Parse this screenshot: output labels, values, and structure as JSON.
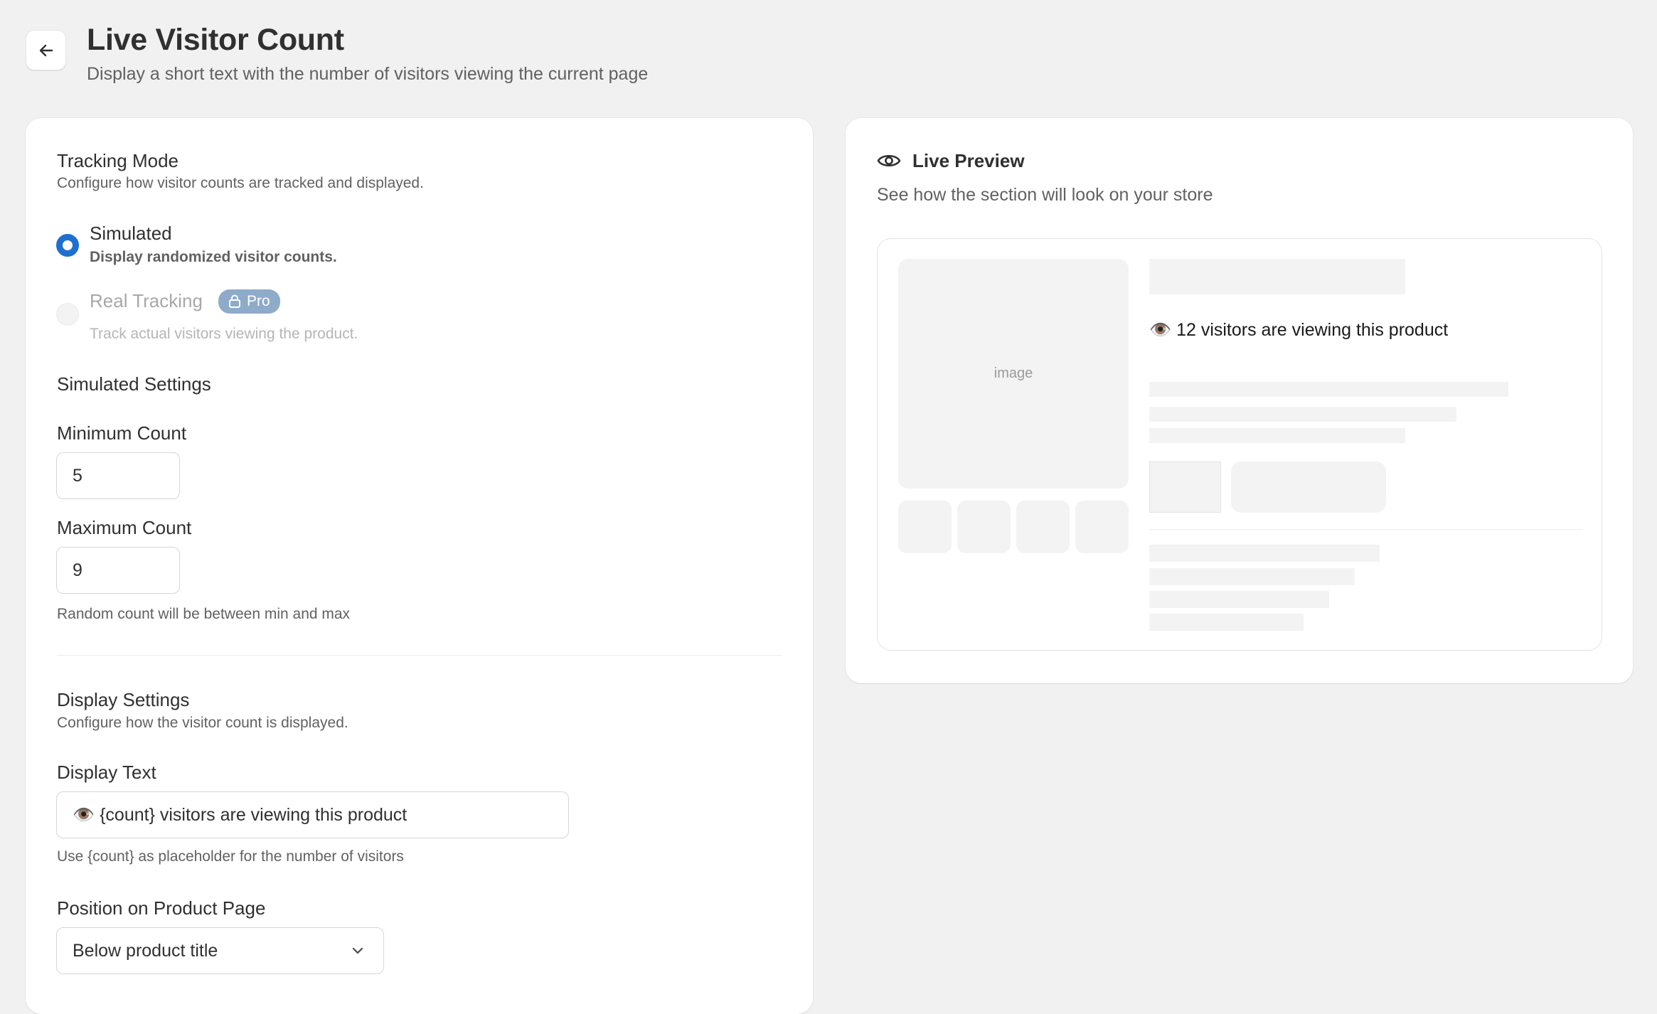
{
  "header": {
    "title": "Live Visitor Count",
    "subtitle": "Display a short text with the number of visitors viewing the current page"
  },
  "tracking": {
    "heading": "Tracking Mode",
    "description": "Configure how visitor counts are tracked and displayed.",
    "options": [
      {
        "label": "Simulated",
        "description": "Display randomized visitor counts.",
        "selected": true
      },
      {
        "label": "Real Tracking",
        "description": "Track actual visitors viewing the product.",
        "badge": "Pro",
        "disabled": true
      }
    ]
  },
  "simulated": {
    "heading": "Simulated Settings",
    "min_label": "Minimum Count",
    "min_value": "5",
    "max_label": "Maximum Count",
    "max_value": "9",
    "help": "Random count will be between min and max"
  },
  "display": {
    "heading": "Display Settings",
    "description": "Configure how the visitor count is displayed.",
    "text_label": "Display Text",
    "text_value": "👁️ {count} visitors are viewing this product",
    "text_help": "Use {count} as placeholder for the number of visitors",
    "position_label": "Position on Product Page",
    "position_value": "Below product title"
  },
  "preview": {
    "heading": "Live Preview",
    "description": "See how the section will look on your store",
    "image_placeholder": "image",
    "visitor_text": "👁️ 12 visitors are viewing this product"
  },
  "colors": {
    "accent": "#1f6fcf",
    "badge": "#8eabc9",
    "background": "#f1f1f1"
  }
}
